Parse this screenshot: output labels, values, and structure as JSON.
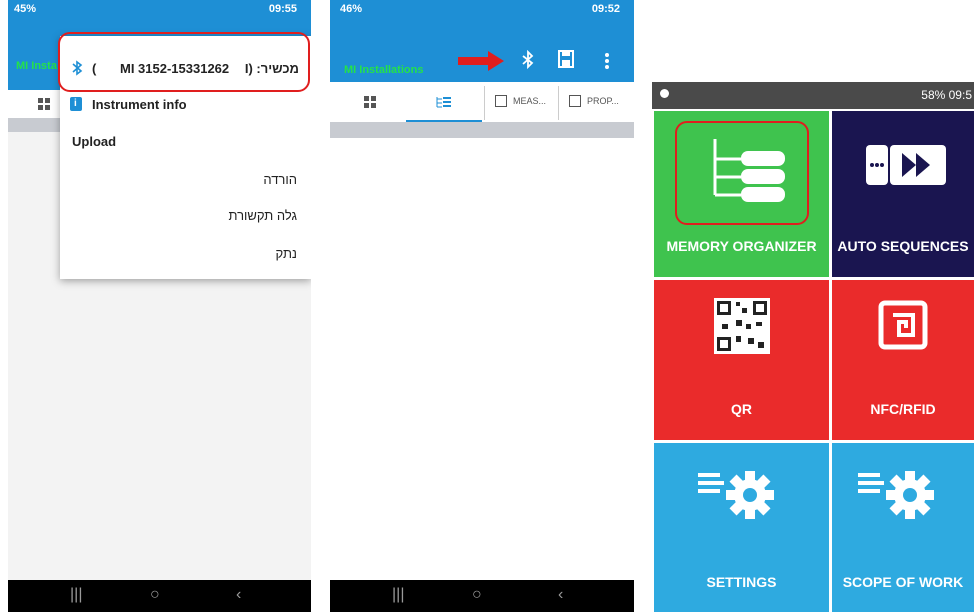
{
  "screen1": {
    "status_left": "45%",
    "status_right": "09:55",
    "app_label": "MI Insta",
    "device_prefix": "מכשיר: (I",
    "device_id": "MI 3152-15331262",
    "device_suffix": ")",
    "menu": {
      "instrument_info": "Instrument info",
      "upload": "Upload",
      "download": "הורדה",
      "discover": "גלה תקשורת",
      "disconnect": "נתק"
    }
  },
  "screen2": {
    "status_left": "46%",
    "status_right": "09:52",
    "app_label": "MI Installations",
    "tabs": [
      "MEAS...",
      "PROP..."
    ]
  },
  "screen3": {
    "status_right": "58%  09:5",
    "tiles": [
      {
        "label": "MEMORY ORGANIZER"
      },
      {
        "label": "AUTO SEQUENCES"
      },
      {
        "label": "QR"
      },
      {
        "label": "NFC/RFID"
      },
      {
        "label": "SETTINGS"
      },
      {
        "label": "SCOPE OF WORK"
      }
    ]
  },
  "colors": {
    "app_bar": "#1e8fd5",
    "highlight": "#e01e1e",
    "tile_green": "#3fc34e",
    "tile_navy": "#1a1550",
    "tile_red": "#ea2b2b",
    "tile_blue": "#2eaae0"
  },
  "icons": [
    "bluetooth-icon",
    "save-icon",
    "more-vert-icon",
    "tree-icon",
    "autoplay-icon",
    "qr-icon",
    "nfc-icon",
    "gear-icon",
    "arrow-icon"
  ]
}
